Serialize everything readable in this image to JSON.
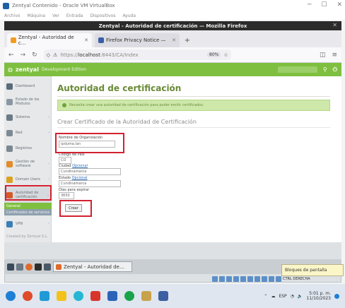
{
  "vbox": {
    "title": "Zentyal Contenido - Oracle VM VirtualBox",
    "menu": [
      "Archivo",
      "Máquina",
      "Ver",
      "Entrada",
      "Dispositivos",
      "Ayuda"
    ]
  },
  "firefox": {
    "window_title": "Zentyal - Autoridad de certificación — Mozilla Firefox",
    "tabs": [
      {
        "label": "Zentyal - Autoridad de c…"
      },
      {
        "label": "Firefox Privacy Notice —"
      }
    ],
    "url_proto": "https://",
    "url_host": "localhost",
    "url_path": ":8443/CA/Index",
    "zoom": "80%"
  },
  "app": {
    "brand": "zentyal",
    "edition": "Development Edition",
    "sidebar": [
      {
        "label": "Dashboard",
        "icon": "dashboard-icon",
        "color": "#5a6b7a"
      },
      {
        "label": "Estado de los Módulos",
        "icon": "modules-icon",
        "color": "#8a96a1"
      },
      {
        "label": "Sistema",
        "icon": "system-icon",
        "color": "#6c7a86"
      },
      {
        "label": "Red",
        "icon": "network-icon",
        "color": "#7d8a94"
      },
      {
        "label": "Registros",
        "icon": "logs-icon",
        "color": "#7b8791"
      },
      {
        "label": "Gestión de software",
        "icon": "software-icon",
        "color": "#e28d28"
      },
      {
        "label": "Domain Users",
        "icon": "users-icon",
        "color": "#d9a21f"
      },
      {
        "label": "Autoridad de certificación",
        "icon": "certificate-icon",
        "color": "#d35a2a"
      },
      {
        "label": "VPN",
        "icon": "vpn-icon",
        "color": "#3a7fb5"
      }
    ],
    "sidebar_subitems": [
      "General",
      "Certificados de servicios"
    ],
    "footer": "Created by Zentyal S.L."
  },
  "page": {
    "title": "Autoridad de certificación",
    "note": "Necesita crear una autoridad de certificación para poder emitir certificados.",
    "section": "Crear Certificado de la Autoridad de Certificación",
    "fields": {
      "org_label": "Nombre de Organización",
      "org_value": "ipduma.lan",
      "country_label": "Código de País",
      "country_value": "CO",
      "city_label": "Ciudad",
      "city_optional": "Opcional",
      "city_value": "Cundinamarca",
      "state_label": "Estado",
      "state_optional": "Opcional",
      "state_value": "Cundinamarca",
      "days_label": "Días para expirar",
      "days_value": "3650"
    },
    "button": "Crear"
  },
  "guest": {
    "task_window": "Zentyal - Autoridad de…",
    "tooltip": "Bloques de pantalla",
    "host_key": "CTRL DERECHA"
  },
  "host": {
    "time": "5:01 p. m.",
    "date": "11/10/2023",
    "lang": "ESP"
  },
  "colors": {
    "zentyal_green": "#7fbf3f",
    "annotation_red": "#d3202f"
  }
}
